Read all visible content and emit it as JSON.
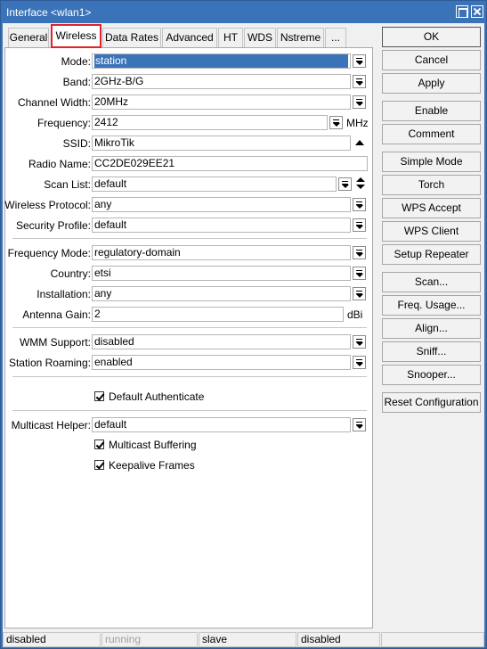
{
  "window": {
    "title": "Interface <wlan1>"
  },
  "tabs": [
    {
      "label": "General"
    },
    {
      "label": "Wireless",
      "active": true
    },
    {
      "label": "Data Rates"
    },
    {
      "label": "Advanced"
    },
    {
      "label": "HT"
    },
    {
      "label": "WDS"
    },
    {
      "label": "Nstreme"
    },
    {
      "label": "..."
    }
  ],
  "form": {
    "mode": {
      "label": "Mode:",
      "value": "station"
    },
    "band": {
      "label": "Band:",
      "value": "2GHz-B/G"
    },
    "channel_width": {
      "label": "Channel Width:",
      "value": "20MHz"
    },
    "frequency": {
      "label": "Frequency:",
      "value": "2412",
      "unit": "MHz"
    },
    "ssid": {
      "label": "SSID:",
      "value": "MikroTik"
    },
    "radio_name": {
      "label": "Radio Name:",
      "value": "CC2DE029EE21"
    },
    "scan_list": {
      "label": "Scan List:",
      "value": "default"
    },
    "wireless_protocol": {
      "label": "Wireless Protocol:",
      "value": "any"
    },
    "security_profile": {
      "label": "Security Profile:",
      "value": "default"
    },
    "frequency_mode": {
      "label": "Frequency Mode:",
      "value": "regulatory-domain"
    },
    "country": {
      "label": "Country:",
      "value": "etsi"
    },
    "installation": {
      "label": "Installation:",
      "value": "any"
    },
    "antenna_gain": {
      "label": "Antenna Gain:",
      "value": "2",
      "unit": "dBi"
    },
    "wmm_support": {
      "label": "WMM Support:",
      "value": "disabled"
    },
    "station_roaming": {
      "label": "Station Roaming:",
      "value": "enabled"
    },
    "default_authenticate": {
      "label": "Default Authenticate",
      "checked": true
    },
    "multicast_helper": {
      "label": "Multicast Helper:",
      "value": "default"
    },
    "multicast_buffering": {
      "label": "Multicast Buffering",
      "checked": true
    },
    "keepalive_frames": {
      "label": "Keepalive Frames",
      "checked": true
    }
  },
  "buttons": {
    "ok": "OK",
    "cancel": "Cancel",
    "apply": "Apply",
    "enable": "Enable",
    "comment": "Comment",
    "simple_mode": "Simple Mode",
    "torch": "Torch",
    "wps_accept": "WPS Accept",
    "wps_client": "WPS Client",
    "setup_repeater": "Setup Repeater",
    "scan": "Scan...",
    "freq_usage": "Freq. Usage...",
    "align": "Align...",
    "sniff": "Sniff...",
    "snooper": "Snooper...",
    "reset_configuration": "Reset Configuration"
  },
  "status": [
    "disabled",
    "running",
    "slave",
    "disabled",
    ""
  ],
  "colors": {
    "titlebar": "#3b73b9",
    "active_tab_outline": "#e0242b",
    "selection": "#3b73b9"
  }
}
